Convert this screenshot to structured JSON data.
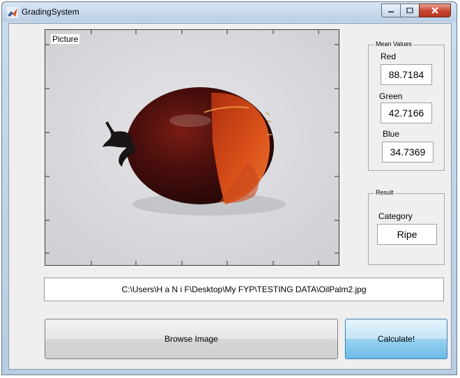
{
  "window": {
    "title": "GradingSystem",
    "background_title": "Grading System"
  },
  "axes": {
    "title": "Picture"
  },
  "mean_values": {
    "legend": "Mean Values",
    "red_label": "Red",
    "red_value": "88.7184",
    "green_label": "Green",
    "green_value": "42.7166",
    "blue_label": "Blue",
    "blue_value": "34.7369"
  },
  "result": {
    "legend": "Result",
    "category_label": "Category",
    "category_value": "Ripe"
  },
  "file_path": "C:\\Users\\H a N i F\\Desktop\\My FYP\\TESTING DATA\\OilPalm2.jpg",
  "buttons": {
    "browse": "Browse Image",
    "calculate": "Calculate!"
  },
  "colors": {
    "fruit_dark": "#3a0c0c",
    "fruit_orange": "#e0561c",
    "calculate_accent": "#6cbde6",
    "close_button": "#c8452f"
  }
}
